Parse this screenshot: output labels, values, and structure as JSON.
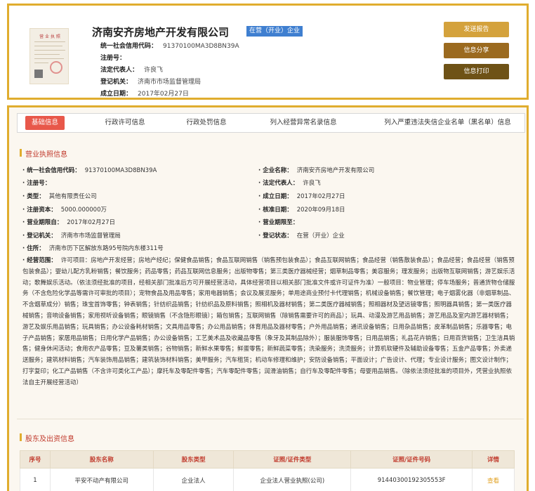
{
  "company": {
    "name": "济南安齐房地产开发有限公司",
    "status": "在营（开业）企业",
    "top_fields": [
      {
        "label": "统一社会信用代码：",
        "value": "91370100MA3D8BN39A"
      },
      {
        "label": "注册号：",
        "value": ""
      },
      {
        "label": "法定代表人：",
        "value": "许良飞"
      },
      {
        "label": "登记机关：",
        "value": "济南市市场监督管理局"
      },
      {
        "label": "成立日期：",
        "value": "2017年02月27日"
      }
    ],
    "license_thumb_title": "营 业 执 照"
  },
  "actions": {
    "send_report": "发送报告",
    "share_info": "信息分享",
    "print_info": "信息打印"
  },
  "colors": {
    "brand_gold": "#e0ad2e",
    "send_btn": "#d4a23c",
    "share_btn": "#9b6a1f",
    "print_btn": "#6e5216",
    "active_tab": "#e8584a",
    "status_tag": "#3f7fd0"
  },
  "tabs": [
    "基础信息",
    "行政许可信息",
    "行政处罚信息",
    "列入经营异常名录信息",
    "列入严重违法失信企业名单（黑名单）信息"
  ],
  "business_license": {
    "section_title": "营业执照信息",
    "left": [
      {
        "label": "统一社会信用代码：",
        "value": "91370100MA3D8BN39A"
      },
      {
        "label": "注册号：",
        "value": ""
      },
      {
        "label": "类型：",
        "value": "其他有限责任公司"
      },
      {
        "label": "注册资本：",
        "value": "5000.000000万"
      },
      {
        "label": "营业期限自：",
        "value": "2017年02月27日"
      },
      {
        "label": "登记机关：",
        "value": "济南市市场监督管理局"
      },
      {
        "label": "住所：",
        "value": "济南市历下区解放东路95号院内东楼311号"
      }
    ],
    "right": [
      {
        "label": "企业名称：",
        "value": "济南安齐房地产开发有限公司"
      },
      {
        "label": "法定代表人：",
        "value": "许良飞"
      },
      {
        "label": "成立日期：",
        "value": "2017年02月27日"
      },
      {
        "label": "核准日期：",
        "value": "2020年09月18日"
      },
      {
        "label": "营业期限至：",
        "value": ""
      },
      {
        "label": "登记状态：",
        "value": "在营（开业）企业"
      }
    ],
    "scope_label": "经营范围：",
    "scope_text": "许可项目：房地产开发经营；房地产经纪；保健食品销售；食品互联网销售（销售预包装食品）；食品互联网销售；食品经营（销售散装食品）；食品经营；食品经营（销售预包装食品）；婴幼儿配方乳粉销售；餐饮服务；药品零售；药品互联网信息服务；出版物零售；第三类医疗器械经营；烟草制品零售；美容服务；理发服务；出版物互联网销售；游艺娱乐活动；歌舞娱乐活动。（依法须经批准的项目，经相关部门批准后方可开展经营活动，具体经营项目以相关部门批准文件或许可证件为准）一般项目：物业管理；停车场服务；普通货物仓储服务（不含危险化学品等需许可审批的项目）；宠物食品及用品零售；家用电器销售；会议及展览服务；单用途商业预付卡代理销售；机械设备销售；餐饮管理；电子烟雾化器（非烟草制品、不含烟草成分）销售；珠宝首饰零售；钟表销售；针纺织品销售；针纺织品及原料销售；照相机及器材销售；第二类医疗器械销售；照相器材及望远镜零售；照明器具销售；第一类医疗器械销售；音响设备销售；家用视听设备销售；眼镜销售（不含隐形眼镜）；箱包销售；互联网销售（除销售需要许可的商品）；玩具、动漫及游艺用品销售；游艺用品及室内游艺器材销售；游艺及娱乐用品销售；玩具销售；办公设备耗材销售；文具用品零售；办公用品销售；体育用品及器材零售；户外用品销售；通讯设备销售；日用杂品销售；皮革制品销售；乐器零售；电子产品销售；家居用品销售；日用化学产品销售；办公设备销售；工艺美术品及收藏品零售（象牙及其制品除外）；服装服饰零售；日用品销售；礼品花卉销售；日用百货销售；卫生洁具销售；健身休闲活动；食用农产品零售；豆及薯类销售；谷物销售；新鲜水果零售；鲜蛋零售；新鲜蔬菜零售；洗染服务；洗烫服务；计算机软硬件及辅助设备零售；五金产品零售；外卖递送服务；建筑材料销售；汽车装饰用品销售；建筑装饰材料销售；美甲服务；汽车租赁；机动车修理和维护；安防设备销售；平面设计；广告设计、代理；专业设计服务；图文设计制作；打字复印；化工产品销售（不含许可类化工产品）；摩托车及零配件零售；汽车零配件零售；润滑油销售；自行车及零配件零售；母婴用品销售。（除依法须经批准的项目外，凭营业执照依法自主开展经营活动）"
  },
  "shareholders": {
    "section_title": "股东及出资信息",
    "columns": [
      "序号",
      "股东名称",
      "股东类型",
      "证照/证件类型",
      "证照/证件号码",
      "详情"
    ],
    "rows": [
      {
        "no": "1",
        "name": "平安不动产有限公司",
        "type": "企业法人",
        "cert_type": "企业法人营业执照(公司)",
        "cert_no": "91440300192305553F",
        "detail": "查看"
      }
    ]
  }
}
